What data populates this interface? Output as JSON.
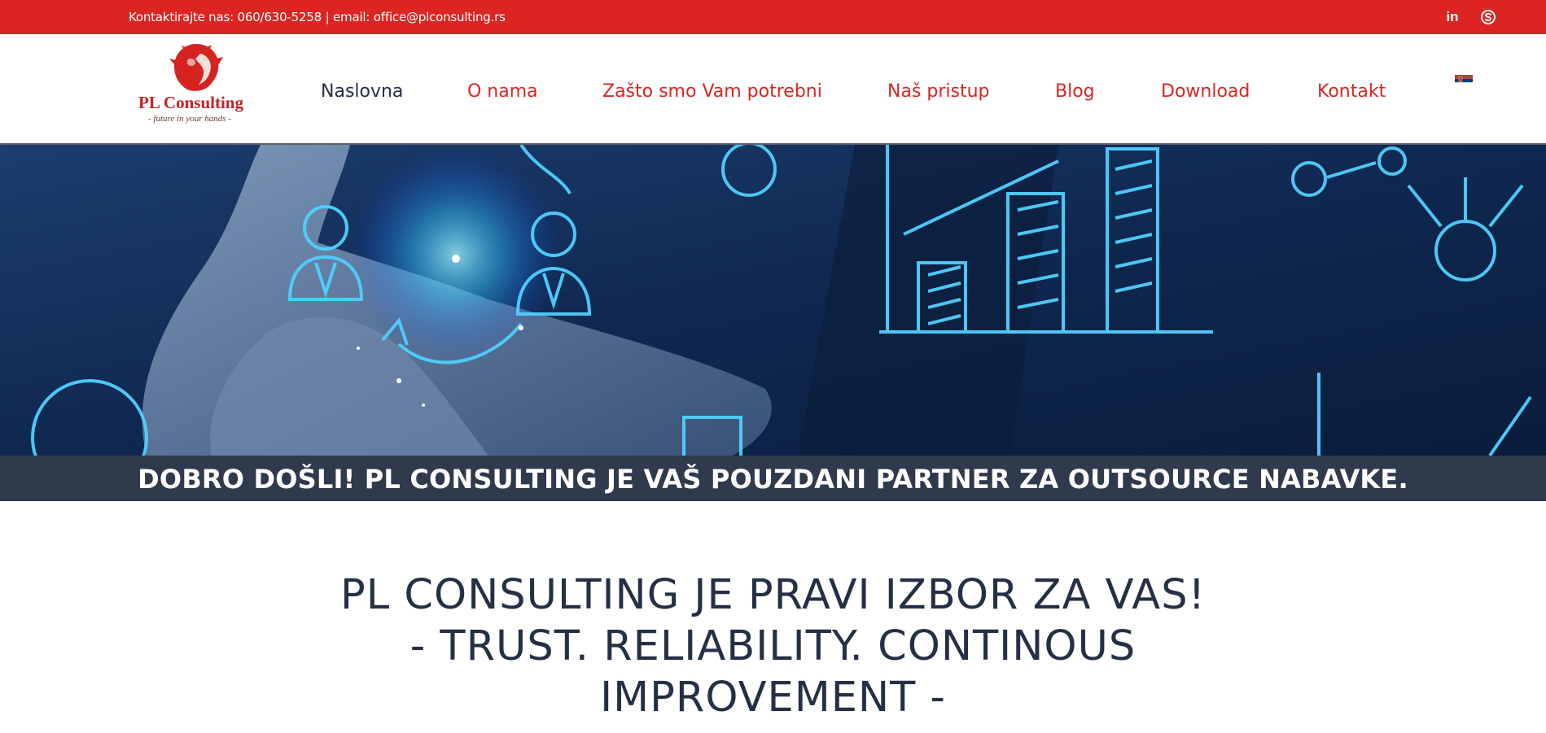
{
  "topbar": {
    "contact_text": "Kontaktirajte nas: 060/630-5258 | email: office@plconsulting.rs",
    "social_icons": [
      "linkedin-icon",
      "skype-icon"
    ],
    "linkedin_label": "in",
    "background_color": "#dc2522"
  },
  "logo": {
    "name": "PL Consulting",
    "tagline": "- future in your hands -",
    "icon": "lion-icon"
  },
  "nav": {
    "items": [
      {
        "label": "Naslovna",
        "active": true
      },
      {
        "label": "O nama"
      },
      {
        "label": "Zašto smo Vam potrebni"
      },
      {
        "label": "Naš pristup"
      },
      {
        "label": "Blog"
      },
      {
        "label": "Download"
      },
      {
        "label": "Kontakt"
      }
    ],
    "language_icon": "serbian-flag-icon"
  },
  "hero": {
    "icon": "hand-touching-business-icons-image"
  },
  "banner": {
    "text": "DOBRO DOŠLI! PL CONSULTING JE VAŠ POUZDANI PARTNER ZA OUTSOURCE NABAVKE."
  },
  "main": {
    "heading_lines": [
      "PL CONSULTING JE PRAVI IZBOR ZA VAS!",
      "- TRUST. RELIABILITY. CONTINOUS",
      "IMPROVEMENT -"
    ]
  },
  "colors": {
    "accent_red": "#dc2522",
    "navy": "#253046",
    "banner_bg": "#2f3a4d"
  }
}
